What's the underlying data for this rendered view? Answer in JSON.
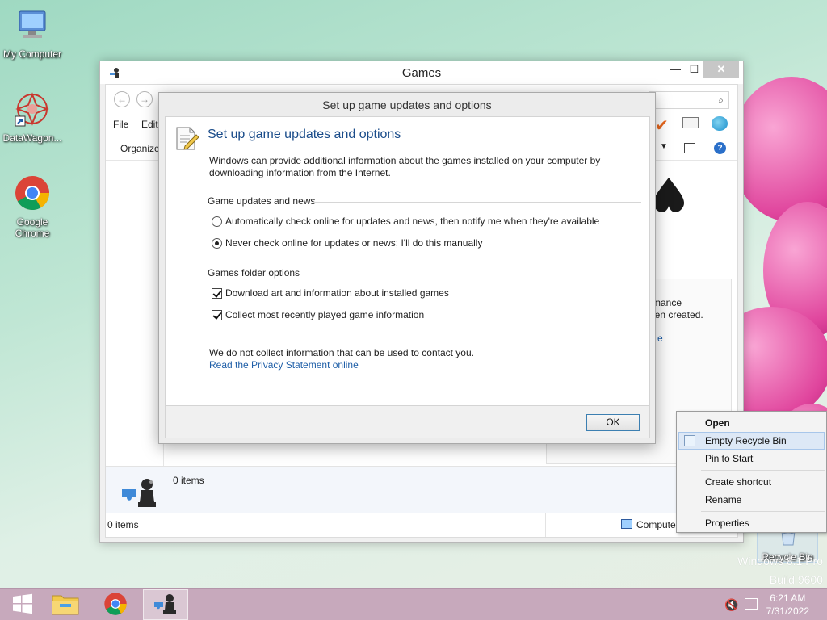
{
  "desktop": {
    "icons": [
      {
        "label": "My Computer"
      },
      {
        "label": "DataWagon..."
      },
      {
        "label": "Google Chrome"
      },
      {
        "label": "Recycle Bin"
      }
    ],
    "watermark_line1": "Windows 8.1 Pro",
    "watermark_line2": "Build 9600"
  },
  "games_window": {
    "title": "Games",
    "menu": {
      "file": "File",
      "edit": "Edit"
    },
    "organize": "Organize",
    "perf_text_line1": "rmance",
    "perf_text_line2": "een created.",
    "perf_link": "e",
    "details_count": "0 items",
    "status_count": "0 items",
    "status_location": "Computer"
  },
  "dialog": {
    "title": "Set up game updates and options",
    "heading": "Set up game updates and options",
    "description": "Windows can provide additional information about the games installed on your computer by downloading information from the Internet.",
    "group_updates": "Game updates and news",
    "radio_auto": "Automatically check online for updates and news, then notify me when they're available",
    "radio_never": "Never check online for updates or news; I'll do this manually",
    "selected_radio": "never",
    "group_folder": "Games folder options",
    "check_art": "Download art and information about installed games",
    "check_art_checked": true,
    "check_recent": "Collect most recently played game information",
    "check_recent_checked": true,
    "privacy_text": "We do not collect information that can be used to contact you.",
    "privacy_link": "Read the Privacy Statement online",
    "ok_label": "OK"
  },
  "context_menu": {
    "items": [
      {
        "label": "Open",
        "bold": true
      },
      {
        "label": "Empty Recycle Bin",
        "highlighted": true
      },
      {
        "label": "Pin to Start"
      },
      {
        "label": "Create shortcut"
      },
      {
        "label": "Rename"
      },
      {
        "label": "Properties"
      }
    ]
  },
  "taskbar": {
    "time": "6:21 AM",
    "date": "7/31/2022"
  },
  "colors": {
    "taskbar": "#c7a9bc",
    "accent_link": "#1f5fa8",
    "heading_blue": "#1a4c8a"
  }
}
